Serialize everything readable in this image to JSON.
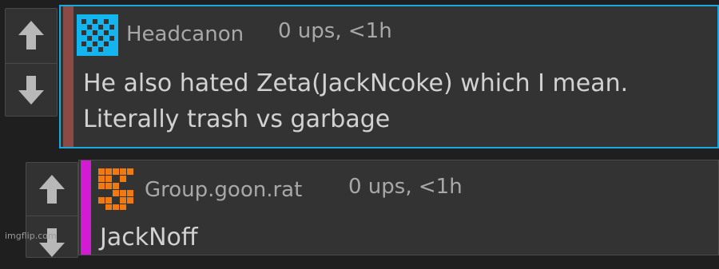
{
  "comments": [
    {
      "username": "Headcanon",
      "meta": "0 ups, <1h",
      "lines": [
        "He also hated Zeta(JackNcoke) which I mean.",
        "Literally trash vs garbage"
      ],
      "stripe_color": "#8b4a44",
      "border_color": "#1aa8de",
      "avatar_color": "#14b4ee"
    },
    {
      "username": "Group.goon.rat",
      "meta": "0 ups, <1h",
      "lines": [
        "JackNoff"
      ],
      "stripe_color": "#d21bd2",
      "border_color": "#4a4a4a",
      "avatar_color": "#f07a10"
    }
  ],
  "icons": [
    "arrow-up-icon",
    "arrow-down-icon"
  ],
  "watermark": "imgflip.com"
}
